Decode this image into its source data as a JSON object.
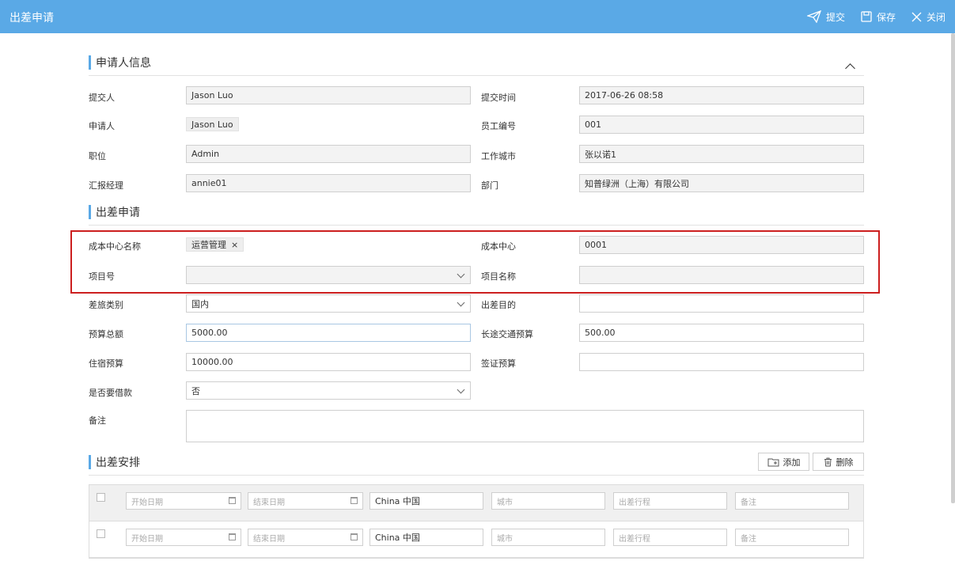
{
  "window": {
    "title": "出差申请"
  },
  "toolbar": {
    "submit_label": "提交",
    "save_label": "保存",
    "close_label": "关闭"
  },
  "sections": {
    "applicant": "申请人信息",
    "trip": "出差申请",
    "schedule": "出差安排"
  },
  "applicant": {
    "submitter_label": "提交人",
    "submitter_value": "Jason Luo",
    "submit_time_label": "提交时间",
    "submit_time_value": "2017-06-26 08:58",
    "applicant_label": "申请人",
    "applicant_value": "Jason Luo",
    "emp_no_label": "员工编号",
    "emp_no_value": "001",
    "position_label": "职位",
    "position_value": "Admin",
    "city_label": "工作城市",
    "city_value": "张以诺1",
    "manager_label": "汇报经理",
    "manager_value": "annie01",
    "dept_label": "部门",
    "dept_value": "知普绿洲（上海）有限公司"
  },
  "trip": {
    "cost_center_name_label": "成本中心名称",
    "cost_center_name_tag": "运营管理",
    "cost_center_label": "成本中心",
    "cost_center_value": "0001",
    "project_no_label": "项目号",
    "project_no_value": "",
    "project_name_label": "项目名称",
    "project_name_value": "",
    "travel_type_label": "差旅类别",
    "travel_type_value": "国内",
    "purpose_label": "出差目的",
    "purpose_value": "",
    "budget_total_label": "预算总额",
    "budget_total_value": "5000.00",
    "long_transport_label": "长途交通预算",
    "long_transport_value": "500.00",
    "lodging_label": "住宿预算",
    "lodging_value": "10000.00",
    "visa_label": "签证预算",
    "visa_value": "",
    "loan_label": "是否要借款",
    "loan_value": "否",
    "remark_label": "备注"
  },
  "schedule": {
    "add_label": "添加",
    "delete_label": "删除",
    "rows": [
      {
        "start_ph": "开始日期",
        "end_ph": "结束日期",
        "country": "China 中国",
        "city_ph": "城市",
        "itinerary_ph": "出差行程",
        "remark_ph": "备注"
      },
      {
        "start_ph": "开始日期",
        "end_ph": "结束日期",
        "country": "China 中国",
        "city_ph": "城市",
        "itinerary_ph": "出差行程",
        "remark_ph": "备注"
      }
    ]
  },
  "colors": {
    "header": "#5aa9e6",
    "accent": "#5aa9e6",
    "highlight": "#cc1f1f"
  },
  "icons": [
    "send-icon",
    "save-icon",
    "close-icon",
    "collapse-icon",
    "chevron-down-icon",
    "folder-add-icon",
    "trash-icon",
    "calendar-icon"
  ]
}
